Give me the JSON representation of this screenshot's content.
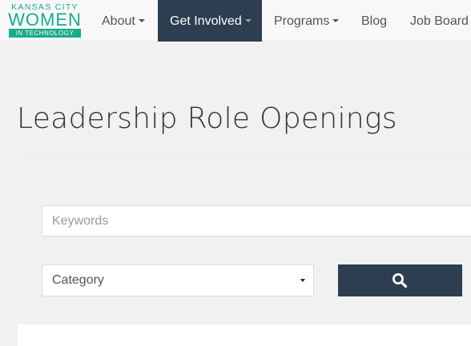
{
  "logo": {
    "line1": "KANSAS CITY",
    "line2": "WOMEN",
    "line3": "IN TECHNOLOGY"
  },
  "nav": {
    "about": "About",
    "get_involved": "Get Involved",
    "programs": "Programs",
    "blog": "Blog",
    "job_board": "Job Board"
  },
  "page": {
    "title": "Leadership Role Openings"
  },
  "search": {
    "keywords_placeholder": "Keywords",
    "category_selected": "Category",
    "button_icon": "search-icon"
  },
  "colors": {
    "brand_teal": "#1aaa8c",
    "nav_active": "#2c3e50",
    "background": "#f1f1f1"
  }
}
